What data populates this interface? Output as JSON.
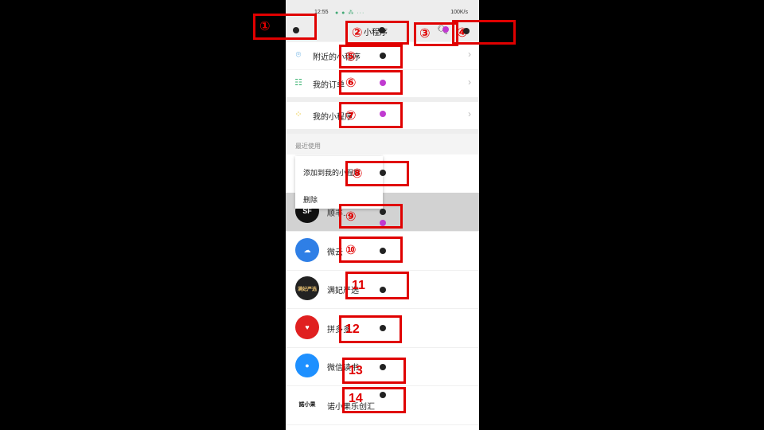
{
  "status_bar": {
    "time": "12:55",
    "speed": "100K/s"
  },
  "nav": {
    "title": "小程序"
  },
  "menu": [
    {
      "label": "附近的小程序",
      "icon": "location-pin-icon"
    },
    {
      "label": "我的订单",
      "icon": "order-list-icon"
    },
    {
      "label": "我的小程序",
      "icon": "grid-apps-icon"
    }
  ],
  "recent_label": "最近使用",
  "context_menu": {
    "add": "添加到我的小程序",
    "delete": "删除"
  },
  "apps": [
    {
      "name": "顺丰...",
      "avatar_text": "SF"
    },
    {
      "name": "微云",
      "avatar_text": ""
    },
    {
      "name": "满妃严选",
      "avatar_text": "满妃严选"
    },
    {
      "name": "拼多多",
      "avatar_text": ""
    },
    {
      "name": "微信读书",
      "avatar_text": ""
    },
    {
      "name": "诺小果乐创汇",
      "avatar_text": "諾小果"
    }
  ],
  "annotations": [
    "①",
    "②",
    "③",
    "④",
    "⑤",
    "⑥",
    "⑦",
    "⑧",
    "⑨",
    "⑩",
    "11",
    "12",
    "13",
    "14"
  ],
  "colors": {
    "annotation": "#e00000",
    "dot_dark": "#222222",
    "dot_magenta": "#c03ad0"
  }
}
